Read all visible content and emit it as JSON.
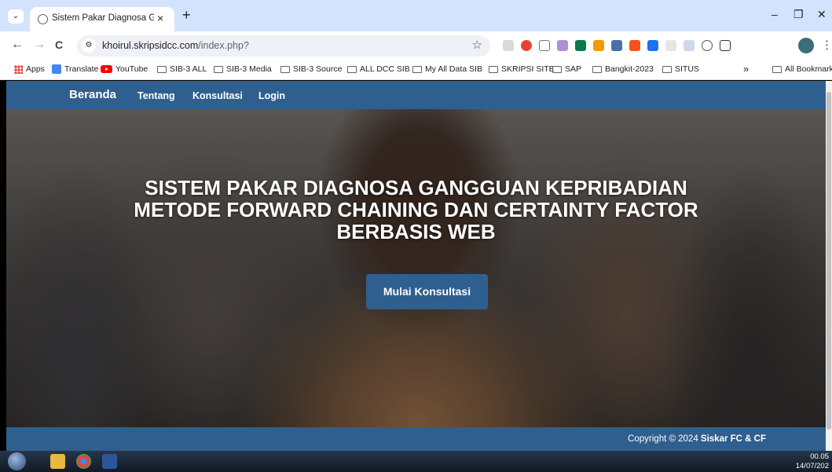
{
  "browser": {
    "tab_title": "Sistem Pakar Diagnosa Ganggu",
    "url_host": "khoirul.skripsidcc.com",
    "url_path": "/index.php?",
    "bookmarks": [
      "Apps",
      "Translate",
      "YouTube",
      "SIB-3 ALL",
      "SIB-3 Media",
      "SIB-3 Source",
      "ALL DCC SIB",
      "My All Data SIB",
      "SKRIPSI SITE",
      "SAP",
      "Bangkit-2023",
      "SITUS"
    ],
    "all_bookmarks": "All Bookmarks",
    "overflow": "»"
  },
  "site": {
    "nav": {
      "brand": "Beranda",
      "links": [
        "Tentang",
        "Konsultasi",
        "Login"
      ]
    },
    "hero": {
      "title_lines": [
        "SISTEM PAKAR DIAGNOSA GANGGUAN KEPRIBADIAN",
        "METODE FORWARD CHAINING DAN CERTAINTY FACTOR",
        "BERBASIS WEB"
      ],
      "cta_label": "Mulai Konsultasi"
    },
    "footer": {
      "copyright_prefix": "Copyright © 2024 ",
      "copyright_brand": "Siskar FC & CF"
    },
    "colors": {
      "primary": "#2f5f8e"
    }
  },
  "taskbar": {
    "time": "00.05",
    "date": "14/07/202"
  },
  "icons": {
    "tab_close": "×",
    "new_tab": "+",
    "back": "←",
    "forward": "→",
    "reload": "C",
    "star": "☆",
    "menu": "⋮",
    "minimize": "–",
    "restore": "❐",
    "close": "✕"
  }
}
